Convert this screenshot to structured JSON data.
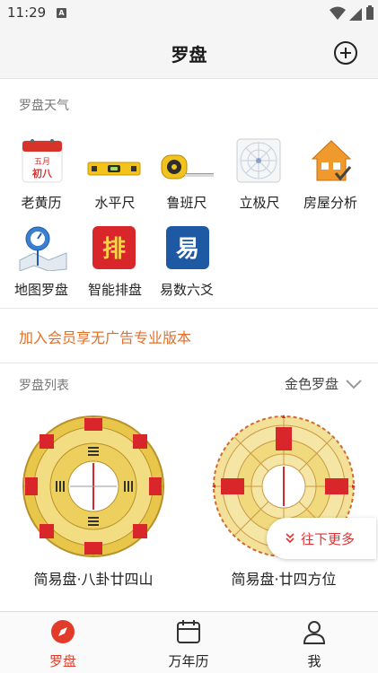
{
  "status_bar": {
    "time": "11:29"
  },
  "header": {
    "title": "罗盘"
  },
  "weather": {
    "label": "罗盘天气"
  },
  "tools": [
    {
      "label": "老黄历",
      "icon": "calendar-icon",
      "icon_text_1": "五月",
      "icon_text_2": "初八"
    },
    {
      "label": "水平尺",
      "icon": "level-icon"
    },
    {
      "label": "鲁班尺",
      "icon": "tape-measure-icon"
    },
    {
      "label": "立极尺",
      "icon": "grid-circle-icon"
    },
    {
      "label": "房屋分析",
      "icon": "house-icon"
    },
    {
      "label": "地图罗盘",
      "icon": "map-pin-icon"
    },
    {
      "label": "智能排盘",
      "icon": "pai-icon",
      "icon_text": "排"
    },
    {
      "label": "易数六爻",
      "icon": "yi-icon",
      "icon_text": "易"
    }
  ],
  "member": {
    "label": "加入会员享无广告专业版本"
  },
  "compass_list": {
    "label": "罗盘列表",
    "filter_value": "金色罗盘",
    "items": [
      {
        "name": "简易盘·八卦廿四山"
      },
      {
        "name": "简易盘·廿四方位"
      }
    ]
  },
  "scroll_more": {
    "label": "往下更多"
  },
  "bottom_nav": [
    {
      "label": "罗盘",
      "active": true,
      "icon": "compass-icon"
    },
    {
      "label": "万年历",
      "active": false,
      "icon": "calendar-outline-icon"
    },
    {
      "label": "我",
      "active": false,
      "icon": "person-icon"
    }
  ],
  "colors": {
    "accent": "#e23b2a",
    "member_link": "#e0702a",
    "gold": "#e8c64a"
  }
}
